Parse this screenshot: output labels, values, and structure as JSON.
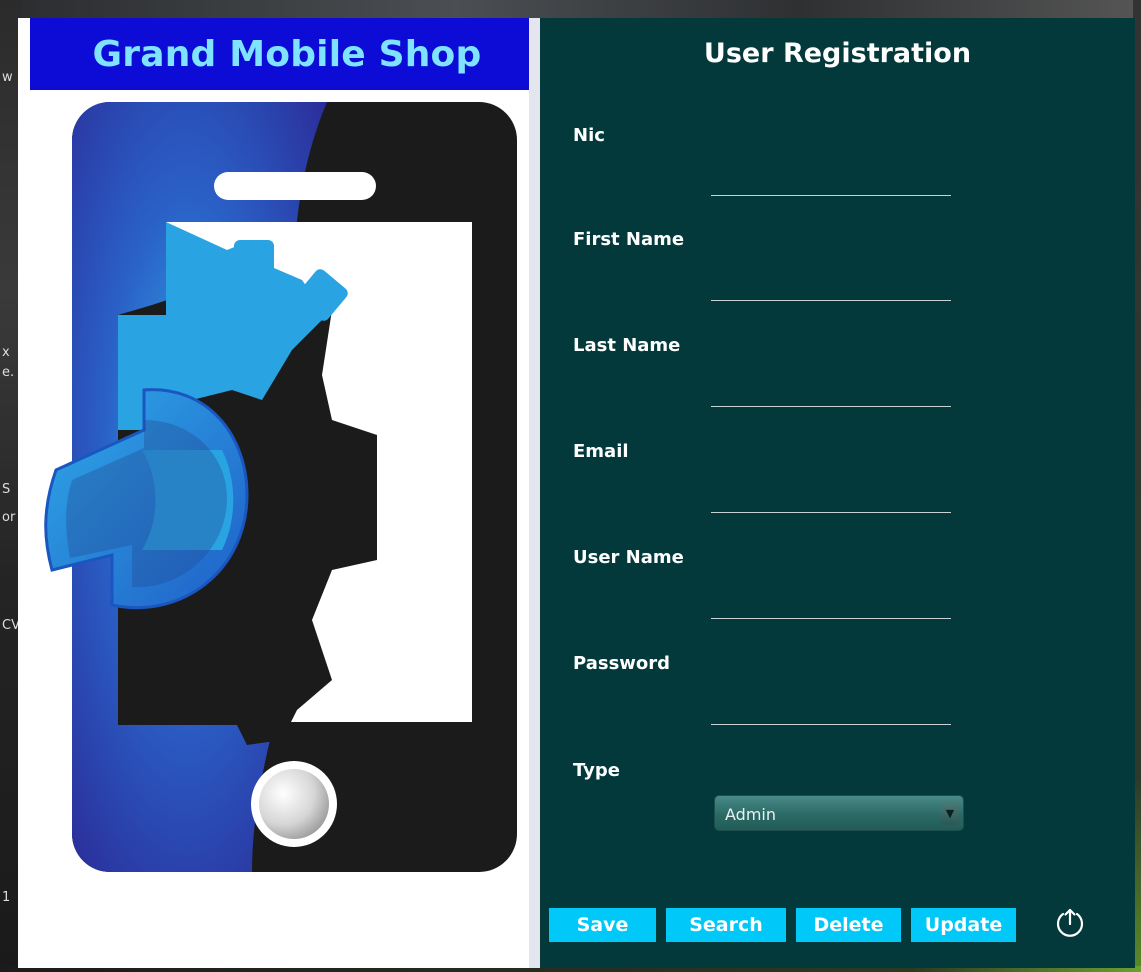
{
  "brand": {
    "title": "Grand Mobile Shop"
  },
  "form": {
    "title": "User Registration",
    "fields": [
      {
        "label": "Nic",
        "value": ""
      },
      {
        "label": "First Name",
        "value": ""
      },
      {
        "label": "Last Name",
        "value": ""
      },
      {
        "label": "Email",
        "value": ""
      },
      {
        "label": "User Name",
        "value": ""
      },
      {
        "label": "Password",
        "value": ""
      }
    ],
    "type": {
      "label": "Type",
      "selected": "Admin"
    }
  },
  "buttons": {
    "save": "Save",
    "search": "Search",
    "delete": "Delete",
    "update": "Update"
  },
  "icons": {
    "upload": "upload-icon",
    "dropdown": "chevron-down-icon",
    "logo": "phone-repair-logo"
  },
  "colors": {
    "brand_bar": "#0c0cd6",
    "brand_text": "#7fe3ff",
    "form_bg": "#03393a",
    "button_bg": "#00c8f8"
  },
  "desktop": {
    "fragments": [
      "w",
      "x",
      "e.",
      "S",
      "or",
      "CV",
      "1"
    ]
  }
}
